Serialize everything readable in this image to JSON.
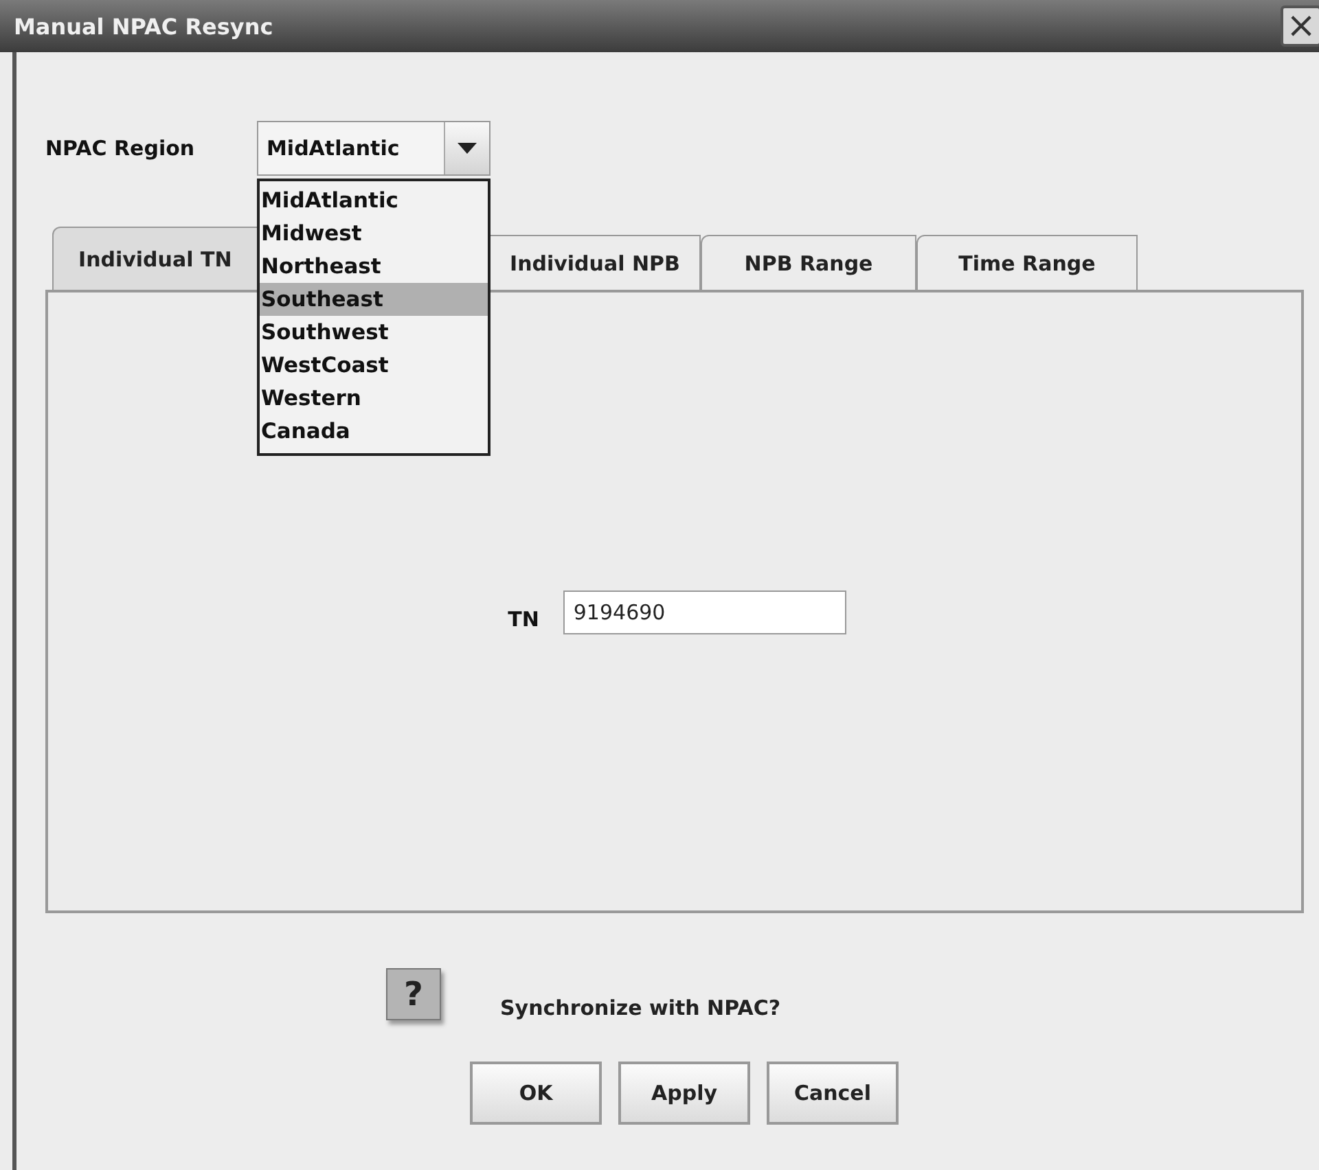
{
  "window": {
    "title": "Manual NPAC Resync",
    "close": "×"
  },
  "region": {
    "label": "NPAC Region",
    "value": "MidAtlantic",
    "expanded": true,
    "options": [
      {
        "label": "MidAtlantic",
        "highlighted": false
      },
      {
        "label": "Midwest",
        "highlighted": false
      },
      {
        "label": "Northeast",
        "highlighted": false
      },
      {
        "label": "Southeast",
        "highlighted": true
      },
      {
        "label": "Southwest",
        "highlighted": false
      },
      {
        "label": "WestCoast",
        "highlighted": false
      },
      {
        "label": "Western",
        "highlighted": false
      },
      {
        "label": "Canada",
        "highlighted": false
      }
    ]
  },
  "tabs": [
    {
      "label": "Individual TN",
      "selected": true
    },
    {
      "label": "Individual NPB",
      "selected": false
    },
    {
      "label": "NPB Range",
      "selected": false
    },
    {
      "label": "Time Range",
      "selected": false
    }
  ],
  "tn": {
    "label": "TN",
    "value": "9194690"
  },
  "prompt": {
    "icon": "?",
    "text": "Synchronize with NPAC?"
  },
  "buttons": [
    "OK",
    "Apply",
    "Cancel"
  ]
}
